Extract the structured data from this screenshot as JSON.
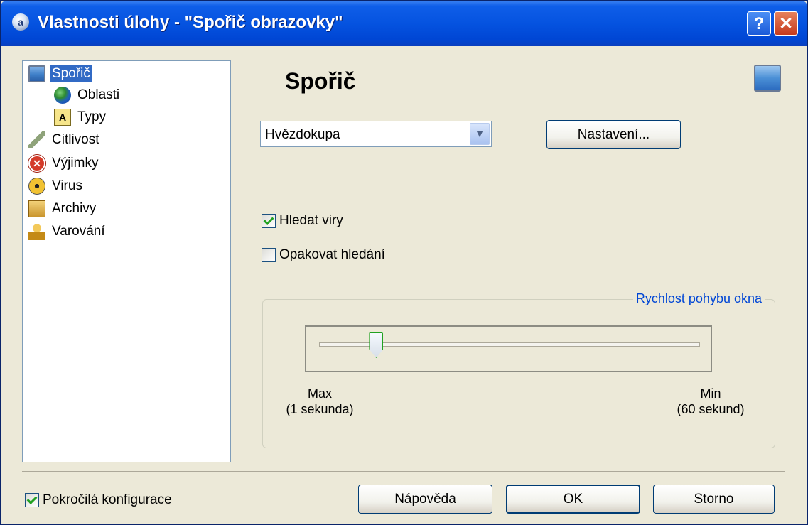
{
  "window": {
    "title": "Vlastnosti úlohy - \"Spořič obrazovky\"",
    "app_icon_glyph": "a",
    "help_glyph": "?",
    "close_glyph": "✕"
  },
  "tree": {
    "items": [
      {
        "label": "Spořič",
        "icon": "monitor-icon",
        "selected": true
      },
      {
        "label": "Oblasti",
        "icon": "globe-icon"
      },
      {
        "label": "Typy",
        "icon": "font-icon",
        "glyph": "A"
      },
      {
        "label": "Citlivost",
        "icon": "feather-icon"
      },
      {
        "label": "Výjimky",
        "icon": "error-x-icon",
        "glyph": "✕"
      },
      {
        "label": "Virus",
        "icon": "radiation-icon"
      },
      {
        "label": "Archivy",
        "icon": "archive-icon"
      },
      {
        "label": "Varování",
        "icon": "user-warning-icon"
      }
    ]
  },
  "panel": {
    "heading": "Spořič",
    "screensaver_select": {
      "value": "Hvězdokupa"
    },
    "settings_button": "Nastavení...",
    "check_search_viruses": {
      "label": "Hledat viry",
      "checked": true
    },
    "check_repeat_search": {
      "label": "Opakovat hledání",
      "checked": false
    },
    "speed_group": {
      "legend": "Rychlost pohybu okna",
      "slider_position": 0.15,
      "max_label": "Max",
      "max_sub": "(1 sekunda)",
      "min_label": "Min",
      "min_sub": "(60 sekund)"
    }
  },
  "footer": {
    "advanced_config": {
      "label": "Pokročilá konfigurace",
      "checked": true
    },
    "help_button": "Nápověda",
    "ok_button": "OK",
    "cancel_button": "Storno"
  },
  "colors": {
    "title_bar": "#0553e0",
    "selection": "#316ac5",
    "legend_text": "#0046d5",
    "check_mark": "#21a121"
  }
}
